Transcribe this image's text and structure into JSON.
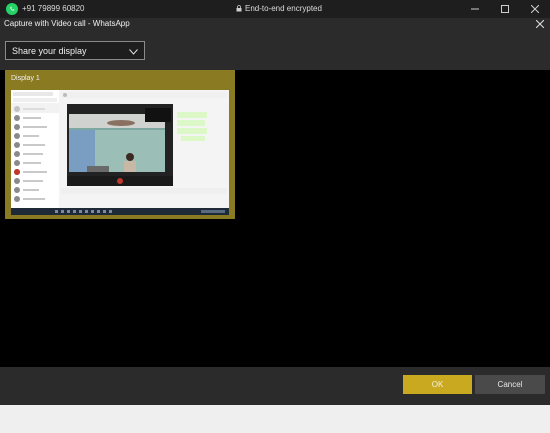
{
  "titlebar": {
    "phone": "+91 79899 60820",
    "encryption": "End-to-end encrypted",
    "icons": [
      "whatsapp-logo",
      "lock-icon",
      "minimize-icon",
      "maximize-icon",
      "close-icon"
    ]
  },
  "dialog": {
    "title": "Capture with Video call - WhatsApp",
    "source_select": {
      "selected": "Share your display"
    },
    "sources": [
      {
        "label": "Display 1"
      }
    ],
    "buttons": {
      "ok": "OK",
      "cancel": "Cancel"
    }
  },
  "colors": {
    "accent": "#c9a91f",
    "thumb_frame": "#8a7a22",
    "stage_bg": "#000000",
    "dialog_bg": "#2b2b2b",
    "whatsapp_green": "#25d366"
  }
}
